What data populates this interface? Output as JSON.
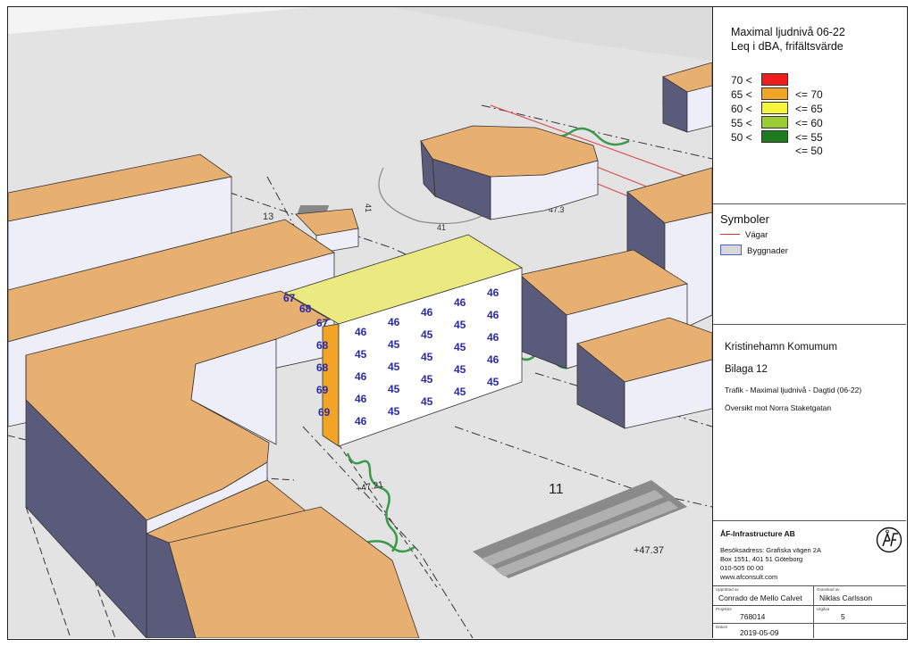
{
  "legend": {
    "title_line1": "Maximal ljudnivå 06-22",
    "title_line2": "Leq i dBA, frifältsvärde",
    "rows": [
      {
        "lo": "70 <",
        "hi": "",
        "color": "#ee1c1c"
      },
      {
        "lo": "65 <",
        "hi": "<= 70",
        "color": "#f2a427"
      },
      {
        "lo": "60 <",
        "hi": "<= 65",
        "color": "#f5f53c"
      },
      {
        "lo": "55 <",
        "hi": "<= 60",
        "color": "#9acd32"
      },
      {
        "lo": "50 <",
        "hi": "<= 55",
        "color": "#1e7a1e"
      }
    ],
    "last_row": "<= 50"
  },
  "symbols": {
    "title": "Symboler",
    "road_label": "Vägar",
    "building_label": "Byggnader"
  },
  "project": {
    "name": "Kristinehamn Komumum",
    "appendix": "Bilaga 12",
    "description": "Trafik -  Maximal ljudnivå - Dagtid (06-22)",
    "view": "Översikt mot Norra Staketgatan"
  },
  "company": {
    "name": "ÅF-Infrastructure AB",
    "address_lines": [
      "Besöksadress: Grafiska vägen 2A",
      "Box 1551, 401 51  Göteborg",
      "010-505 00 00",
      "www.afconsult.com"
    ]
  },
  "titleblock": {
    "drawn_by_label": "Upprättad av",
    "drawn_by": "Conrado de Mello Calvet",
    "checked_by_label": "Granskad av",
    "checked_by": "Niklas Carlsson",
    "project_label": "Projektnr",
    "project_no": "768014",
    "revision_label": "Utgåva",
    "revision": "5",
    "date_label": "Datum",
    "date": "2019-05-09"
  },
  "map": {
    "property_labels": [
      "13",
      "41",
      "11",
      "+47.37",
      "+47.21",
      "41",
      "47.3"
    ],
    "front_facade_levels": [
      [
        "46",
        "46",
        "46",
        "46",
        "46"
      ],
      [
        "45",
        "45",
        "45",
        "45",
        "46"
      ],
      [
        "46",
        "45",
        "45",
        "45",
        "46"
      ],
      [
        "46",
        "45",
        "45",
        "45",
        "46"
      ],
      [
        "46",
        "45",
        "45",
        "45",
        "45"
      ]
    ],
    "side_facade_levels": [
      "67",
      "68",
      "67",
      "68",
      "68",
      "69",
      "69"
    ]
  }
}
